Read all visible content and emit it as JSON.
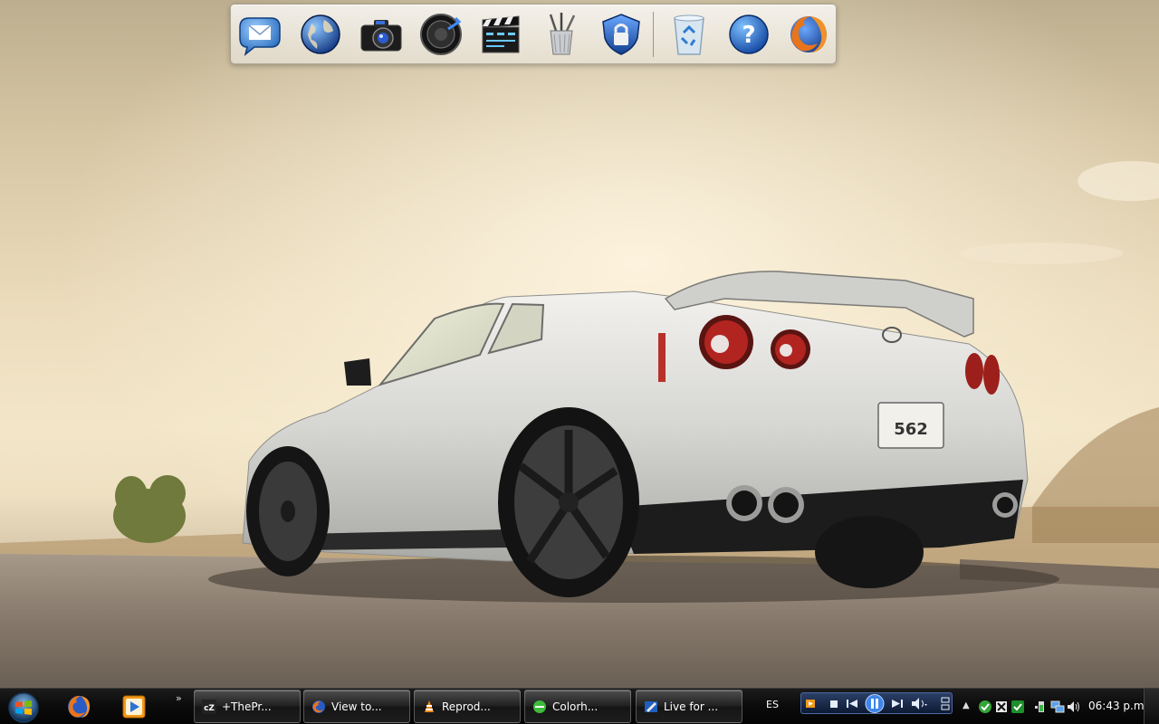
{
  "dock": {
    "items": [
      {
        "name": "mail-icon",
        "label": ""
      },
      {
        "name": "globe-icon",
        "label": ""
      },
      {
        "name": "camera-icon",
        "label": ""
      },
      {
        "name": "speaker-icon",
        "label": ""
      },
      {
        "name": "clapperboard-icon",
        "label": ""
      },
      {
        "name": "pencil-cup-icon",
        "label": ""
      },
      {
        "name": "security-shield-icon",
        "label": ""
      },
      {
        "name": "recycle-bin-icon",
        "label": ""
      },
      {
        "name": "help-icon",
        "label": ""
      },
      {
        "name": "firefox-icon",
        "label": ""
      }
    ]
  },
  "taskbar": {
    "quick_launch": [
      "firefox-icon",
      "media-player-icon"
    ],
    "overflow_glyph": "»",
    "tasks": [
      {
        "icon": "cz-icon",
        "label": "+ThePr..."
      },
      {
        "icon": "firefox-icon",
        "label": "View to..."
      },
      {
        "icon": "vlc-cone-icon",
        "label": "Reprod..."
      },
      {
        "icon": "green-dot-icon",
        "label": "Colorh..."
      },
      {
        "icon": "live-writer-icon",
        "label": "Live for ..."
      }
    ],
    "language": "ES",
    "clock": "06:43 p.m."
  },
  "colors": {
    "taskbar": "#0b0b0b",
    "dock": "#ece8e0",
    "sky": "#efe0c2",
    "car": "#d9d9d6"
  }
}
